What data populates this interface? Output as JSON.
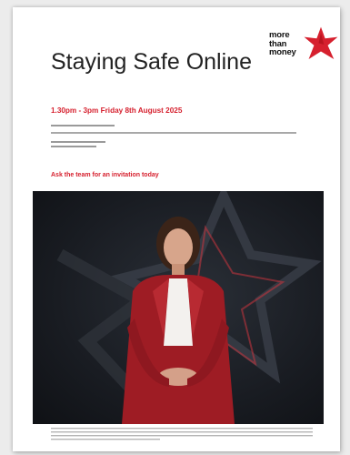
{
  "logo": {
    "text": "more\nthan\nmoney",
    "color": "#d6202e",
    "icon": "red-star-icon"
  },
  "event": {
    "title": "Staying Safe Online",
    "datetime": "1.30pm - 3pm Friday 8th August 2025",
    "cta": "Ask the team for an invitation today",
    "accent": "#d6202e"
  },
  "photo": {
    "subject": "woman-in-red-blazer",
    "icon": "star-outline-graphic"
  }
}
